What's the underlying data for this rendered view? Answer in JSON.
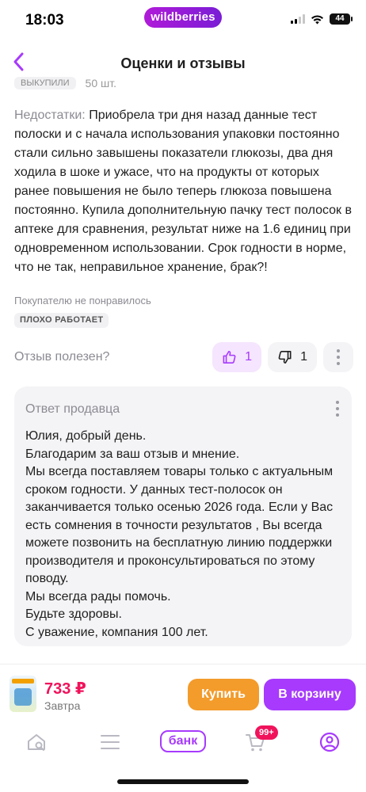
{
  "status_bar": {
    "time": "18:03",
    "brand": "wildberries",
    "battery": "44"
  },
  "header": {
    "back_icon": "chevron-left-icon",
    "title": "Оценки и отзывы"
  },
  "review": {
    "cut_chip": "выкупили",
    "cut_value": "50 шт.",
    "cons_label": "Недостатки:",
    "cons_text": " Приобрела три дня назад данные тест полоски и с начала использования упаковки постоянно стали сильно завышены показатели глюкозы, два дня ходила в шоке и ужасе, что на продукты от которых ранее повышения не было теперь глюкоза повышена постоянно. Купила дополнительную пачку тест полосок в аптеке для сравнения, результат ниже на 1.6 единиц при одновременном использовании. Срок годности в норме, что не так, неправильное хранение, брак?!",
    "disliked": "Покупателю не понравилось",
    "tag": "ПЛОХО РАБОТАЕТ",
    "helpful_question": "Отзыв полезен?",
    "likes": "1",
    "dislikes": "1"
  },
  "seller_reply": {
    "title": "Ответ продавца",
    "lines": [
      "Юлия, добрый день.",
      "Благодарим за ваш отзыв и мнение.",
      "Мы всегда поставляем товары только с актуальным сроком годности. У данных тест-полосок он заканчивается только осенью 2026 года. Если у Вас есть сомнения в точности результатов , Вы всегда можете позвонить на бесплатную линию поддержки производителя и проконсультироваться по этому поводу.",
      "Мы всегда рады помочь.",
      "Будьте здоровы.",
      "С уважение, компания 100 лет."
    ]
  },
  "purchase": {
    "price": "733 ₽",
    "delivery": "Завтра",
    "buy_label": "Купить",
    "cart_label": "В корзину"
  },
  "tab_bar": {
    "bank_label": "банк",
    "cart_badge": "99+"
  },
  "colors": {
    "accent": "#a73afd",
    "price": "#f0135c",
    "buy": "#f39b2b"
  }
}
